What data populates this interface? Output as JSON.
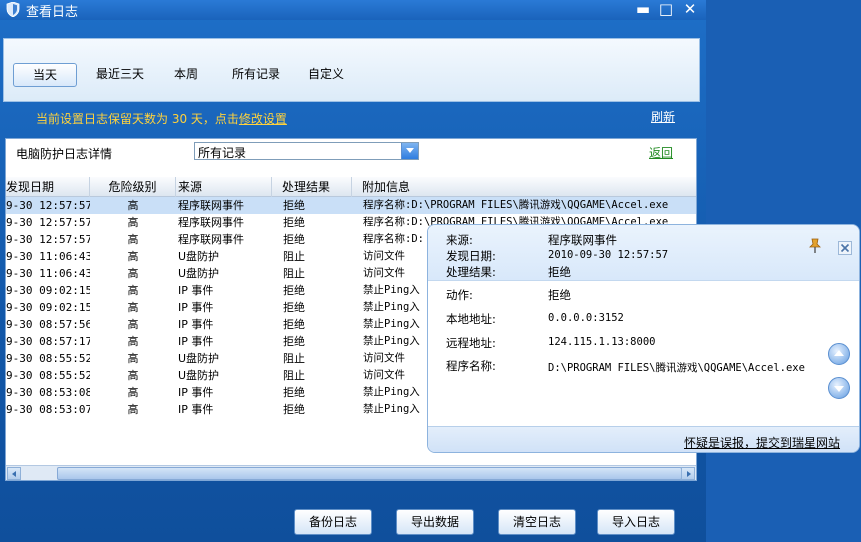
{
  "window": {
    "title": "查看日志",
    "minimize_glyph": "▬",
    "maximize_glyph": "□",
    "close_glyph": "✕"
  },
  "tabs": [
    {
      "label": "当天",
      "active": true
    },
    {
      "label": "最近三天",
      "active": false
    },
    {
      "label": "本周",
      "active": false
    },
    {
      "label": "所有记录",
      "active": false
    },
    {
      "label": "自定义",
      "active": false
    }
  ],
  "notice": {
    "text": "当前设置日志保留天数为 30 天，点击",
    "link": "修改设置"
  },
  "refresh_label": "刷新",
  "filter": {
    "label": "电脑防护日志详情",
    "selected": "所有记录"
  },
  "back_label": "返回",
  "grid": {
    "columns": [
      "发现日期",
      "危险级别",
      "来源",
      "处理结果",
      "附加信息"
    ],
    "rows": [
      [
        "9-30 12:57:57",
        "高",
        "程序联网事件",
        "拒绝",
        "程序名称:D:\\PROGRAM FILES\\腾讯游戏\\QQGAME\\Accel.exe"
      ],
      [
        "9-30 12:57:57",
        "高",
        "程序联网事件",
        "拒绝",
        "程序名称:D:\\PROGRAM FILES\\腾讯游戏\\QQGAME\\Accel.exe"
      ],
      [
        "9-30 12:57:57",
        "高",
        "程序联网事件",
        "拒绝",
        "程序名称:D:"
      ],
      [
        "9-30 11:06:43",
        "高",
        "U盘防护",
        "阻止",
        "访问文件"
      ],
      [
        "9-30 11:06:43",
        "高",
        "U盘防护",
        "阻止",
        "访问文件"
      ],
      [
        "9-30 09:02:15",
        "高",
        "IP 事件",
        "拒绝",
        "禁止Ping入"
      ],
      [
        "9-30 09:02:15",
        "高",
        "IP 事件",
        "拒绝",
        "禁止Ping入"
      ],
      [
        "9-30 08:57:56",
        "高",
        "IP 事件",
        "拒绝",
        "禁止Ping入"
      ],
      [
        "9-30 08:57:17",
        "高",
        "IP 事件",
        "拒绝",
        "禁止Ping入"
      ],
      [
        "9-30 08:55:52",
        "高",
        "U盘防护",
        "阻止",
        "访问文件"
      ],
      [
        "9-30 08:55:52",
        "高",
        "U盘防护",
        "阻止",
        "访问文件"
      ],
      [
        "9-30 08:53:08",
        "高",
        "IP 事件",
        "拒绝",
        "禁止Ping入"
      ],
      [
        "9-30 08:53:07",
        "高",
        "IP 事件",
        "拒绝",
        "禁止Ping入"
      ]
    ],
    "selected_row": 0
  },
  "buttons": {
    "backup": "备份日志",
    "export": "导出数据",
    "clear": "清空日志",
    "import": "导入日志"
  },
  "popup": {
    "source_label": "来源:",
    "source_value": "程序联网事件",
    "date_label": "发现日期:",
    "date_value": "2010-09-30 12:57:57",
    "result_label": "处理结果:",
    "result_value": "拒绝",
    "action_label": "动作:",
    "action_value": "拒绝",
    "local_label": "本地地址:",
    "local_value": "0.0.0.0:3152",
    "remote_label": "远程地址:",
    "remote_value": "124.115.1.13:8000",
    "program_label": "程序名称:",
    "program_value": "D:\\PROGRAM FILES\\腾讯游戏\\QQGAME\\Accel.exe",
    "report_link": "怀疑是误报，提交到瑞星网站"
  },
  "colors": {
    "window_blue": "#1257a8",
    "notice_yellow": "#ffd23c",
    "back_green": "#228b22",
    "selected_row": "#c9dff7"
  },
  "icons": {
    "app": "shield-icon",
    "pin": "pin-icon",
    "close": "close-icon",
    "scroll_up": "chevron-up-icon",
    "scroll_down": "chevron-down-icon"
  }
}
